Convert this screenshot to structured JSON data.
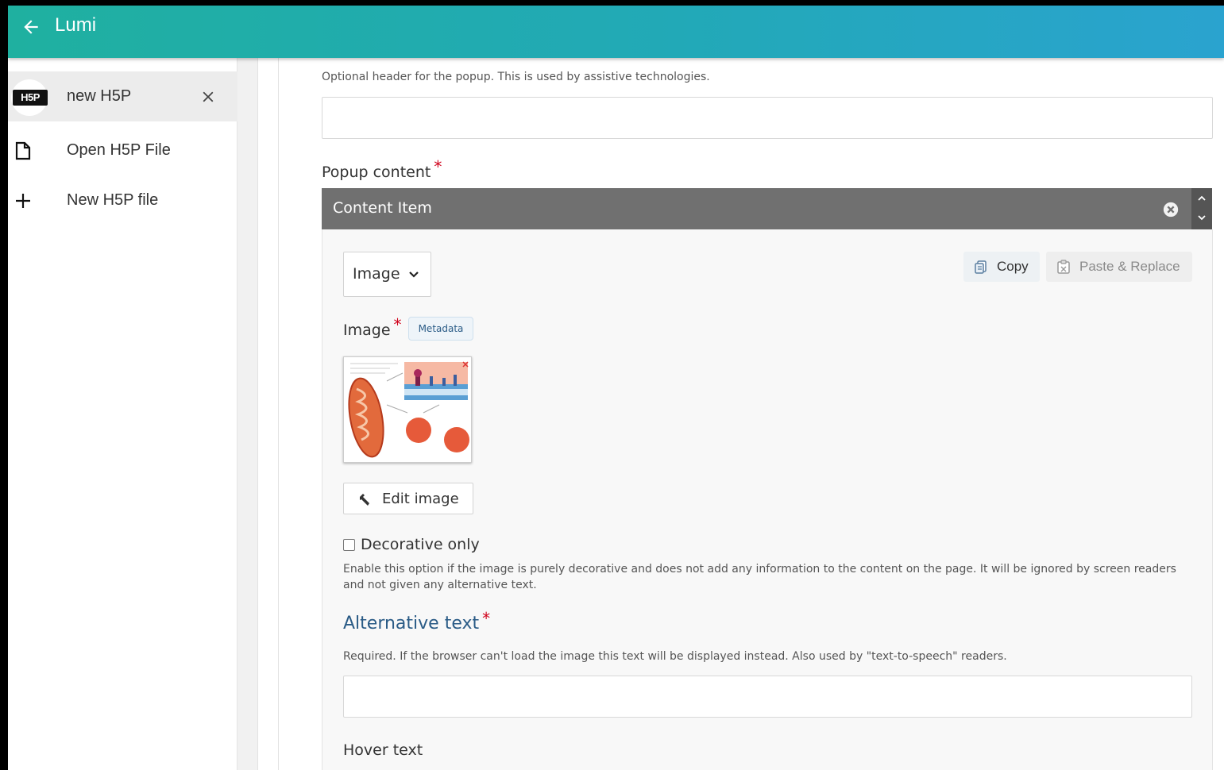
{
  "app": {
    "title": "Lumi"
  },
  "sidebar": {
    "items": [
      {
        "label": "new H5P",
        "badge": "H5P",
        "active": true
      },
      {
        "label": "Open H5P File",
        "icon": "file-icon"
      },
      {
        "label": "New H5P file",
        "icon": "plus-icon"
      }
    ]
  },
  "editor": {
    "header_desc": "Optional header for the popup. This is used by assistive technologies.",
    "popup_content_label": "Popup content",
    "required_mark": "*",
    "content_item": {
      "title": "Content Item",
      "library_select": "Image",
      "copy_label": "Copy",
      "paste_label": "Paste & Replace",
      "image_label": "Image",
      "metadata_label": "Metadata",
      "edit_image_label": "Edit image",
      "decorative_label": "Decorative only",
      "decorative_checked": false,
      "decorative_desc": "Enable this option if the image is purely decorative and does not add any information to the content on the page. It will be ignored by screen readers and not given any alternative text.",
      "alt_text_label": "Alternative text",
      "alt_text_desc": "Required. If the browser can't load the image this text will be displayed instead. Also used by \"text-to-speech\" readers.",
      "alt_text_value": "",
      "hover_text_label": "Hover text"
    }
  },
  "colors": {
    "topbar_start": "#1fb0a0",
    "topbar_end": "#2aa3cf",
    "group_header": "#707070",
    "required": "#d0021b",
    "link_blue": "#2a5b86"
  }
}
